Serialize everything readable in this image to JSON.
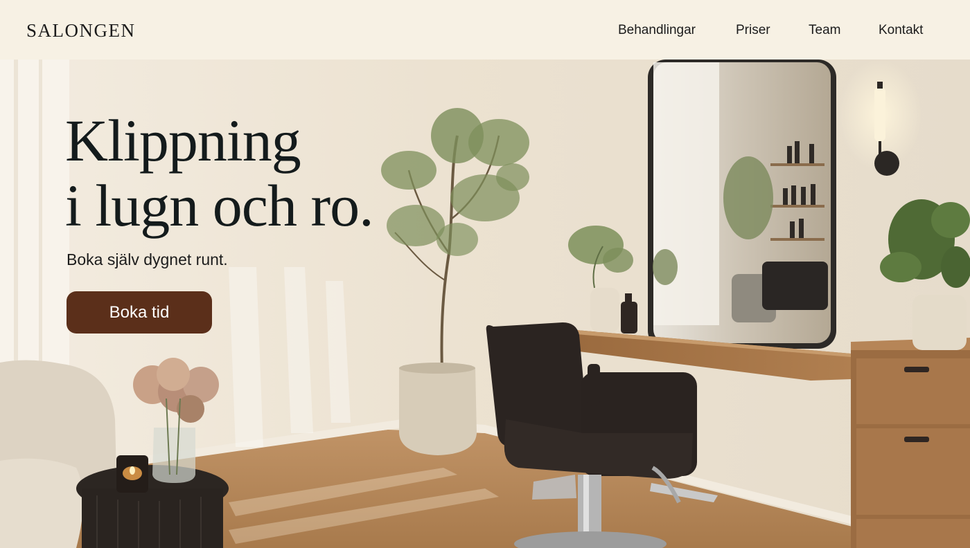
{
  "brand": {
    "name": "SALONGEN"
  },
  "nav": {
    "items": [
      {
        "label": "Behandlingar"
      },
      {
        "label": "Priser"
      },
      {
        "label": "Team"
      },
      {
        "label": "Kontakt"
      }
    ]
  },
  "hero": {
    "headline_line1": "Klippning",
    "headline_line2": "i lugn och ro.",
    "subheading": "Boka själv dygnet runt.",
    "cta_label": "Boka tid"
  },
  "colors": {
    "header_bg": "#f7f1e4",
    "wall": "#ece3d2",
    "floor": "#b38656",
    "cta_bg": "#5b2f1a",
    "text": "#141b1c"
  }
}
